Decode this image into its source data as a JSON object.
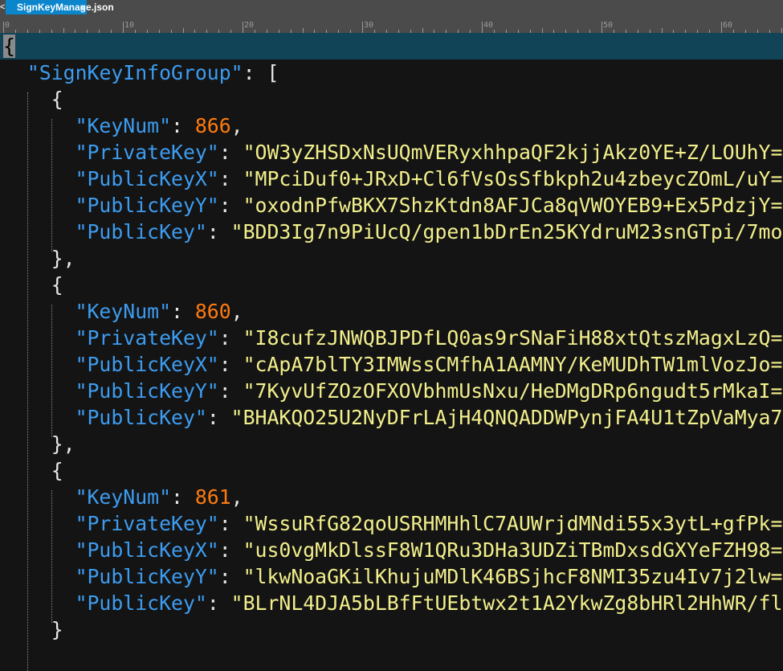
{
  "tab": {
    "title": "SignKeyManage.json",
    "close": "x",
    "scroll_left": "<"
  },
  "ruler": {
    "labels": [
      "0",
      "10",
      "20",
      "30",
      "40",
      "50",
      "60"
    ]
  },
  "json": {
    "root_key": "SignKeyInfoGroup",
    "groups": [
      {
        "KeyNum": "866",
        "PrivateKey": "OW3yZHSDxNsUQmVERyxhhpaQF2kjjAkz0YE+Z/LOUhY=",
        "PublicKeyX": "MPciDuf0+JRxD+Cl6fVsOsSfbkph2u4zbeycZOmL/uY=",
        "PublicKeyY": "oxodnPfwBKX7ShzKtdn8AFJCa8qVWOYEB9+Ex5PdzjY=",
        "PublicKey": "BDD3Ig7n9PiUcQ/gpen1bDrEn25KYdruM23snGTpi/7mo"
      },
      {
        "KeyNum": "860",
        "PrivateKey": "I8cufzJNWQBJPDfLQ0as9rSNaFiH88xtQtszMagxLzQ=",
        "PublicKeyX": "cApA7blTY3IMWssCMfhA1AAMNY/KeMUDhTW1mlVozJo=",
        "PublicKeyY": "7KyvUfZOzOFXOVbhmUsNxu/HeDMgDRp6ngudt5rMkaI=",
        "PublicKey": "BHAKQO25U2NyDFrLAjH4QNQADDWPynjFA4U1tZpVaMya7"
      },
      {
        "KeyNum": "861",
        "PrivateKey": "WssuRfG82qoUSRHMHhlC7AUWrjdMNdi55x3ytL+gfPk=",
        "PublicKeyX": "us0vgMkDlssF8W1QRu3DHa3UDZiTBmDxsdGXYeFZH98=",
        "PublicKeyY": "lkwNoaGKilKhujuMDlK46BSjhcF8NMI35zu4Iv7j2lw=",
        "PublicKey": "BLrNL4DJA5bLBfFtUEbtwx2t1A2YkwZg8bHRl2HhWR/fl"
      }
    ]
  }
}
